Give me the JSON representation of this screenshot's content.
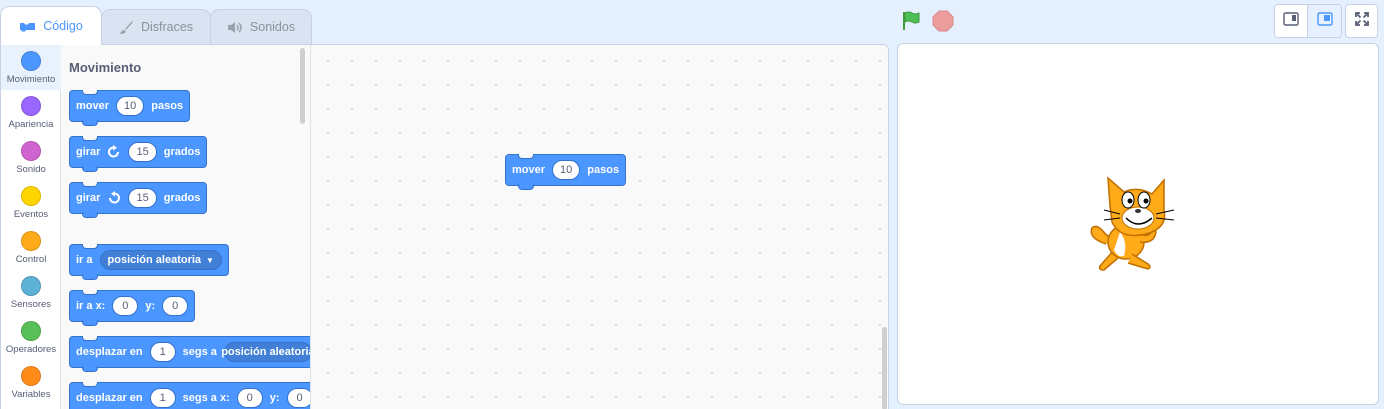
{
  "tabs": [
    {
      "label": "Código",
      "icon": "code-icon",
      "active": true
    },
    {
      "label": "Disfraces",
      "icon": "brush-icon",
      "active": false
    },
    {
      "label": "Sonidos",
      "icon": "speaker-icon",
      "active": false
    }
  ],
  "categories": [
    {
      "label": "Movimiento",
      "color": "#4c97ff",
      "selected": true
    },
    {
      "label": "Apariencia",
      "color": "#9966ff"
    },
    {
      "label": "Sonido",
      "color": "#cf63cf"
    },
    {
      "label": "Eventos",
      "color": "#ffd500"
    },
    {
      "label": "Control",
      "color": "#ffab19"
    },
    {
      "label": "Sensores",
      "color": "#5cb1d6"
    },
    {
      "label": "Operadores",
      "color": "#59c059"
    },
    {
      "label": "Variables",
      "color": "#ff8c1a"
    }
  ],
  "palette": {
    "title": "Movimiento",
    "blocks": {
      "move": {
        "text1": "mover",
        "value": "10",
        "text2": "pasos"
      },
      "turn_right": {
        "text1": "girar",
        "icon": "rotate-right-icon",
        "value": "15",
        "text2": "grados"
      },
      "turn_left": {
        "text1": "girar",
        "icon": "rotate-left-icon",
        "value": "15",
        "text2": "grados"
      },
      "goto": {
        "text1": "ir a",
        "dropdown": "posición aleatoria"
      },
      "goto_xy": {
        "text1": "ir a x:",
        "x": "0",
        "text2": "y:",
        "y": "0"
      },
      "glide_to": {
        "text1": "desplazar en",
        "secs": "1",
        "text2": "segs a",
        "dropdown": "posición aleatoria"
      },
      "glide_xy": {
        "text1": "desplazar en",
        "secs": "1",
        "text2": "segs a x:",
        "x": "0",
        "text3": "y:",
        "y": "0"
      }
    }
  },
  "script": {
    "block": {
      "text1": "mover",
      "value": "10",
      "text2": "pasos"
    }
  },
  "stage": {
    "green_flag": "green-flag-icon",
    "stop": "stop-icon",
    "sprite": "cat-sprite"
  },
  "colors": {
    "motion": "#4c97ff",
    "motion_border": "#3373cc",
    "accent": "#4c97ff",
    "flag": "#4cbf56",
    "stop": "#ec9c9c"
  }
}
